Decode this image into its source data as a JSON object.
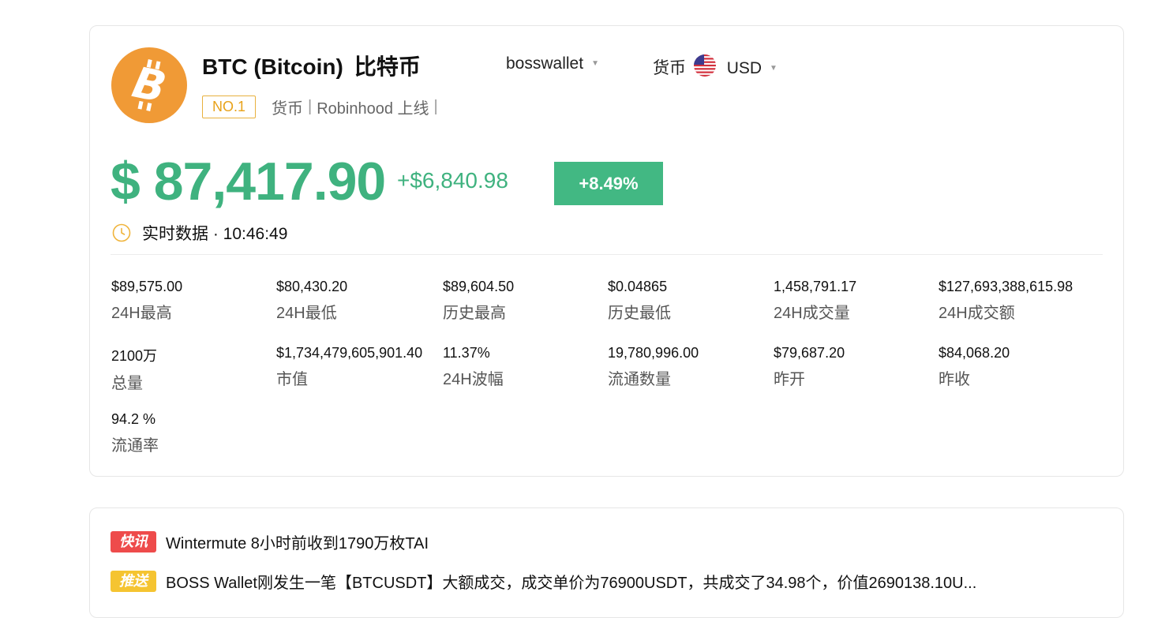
{
  "coin": {
    "symbol_name": "BTC (Bitcoin)",
    "cn_name": "比特币",
    "logo_glyph": "B",
    "logo_color": "#f09a36"
  },
  "wallet_select": {
    "value": "bosswallet"
  },
  "currency_select": {
    "label": "货币",
    "value": "USD",
    "flag": "us-flag-icon"
  },
  "tags": {
    "rank": "NO.1",
    "category": "货币",
    "sep": "|",
    "listing": "Robinhood 上线"
  },
  "price": {
    "value": "$ 87,417.90",
    "change_abs": "+$6,840.98",
    "change_pct": "+8.49%",
    "color": "#3fb27f"
  },
  "realtime": {
    "label": "实时数据 · 10:46:49"
  },
  "stats": [
    {
      "value": "$89,575.00",
      "label": "24H最高"
    },
    {
      "value": "$80,430.20",
      "label": "24H最低"
    },
    {
      "value": "$89,604.50",
      "label": "历史最高"
    },
    {
      "value": "$0.04865",
      "label": "历史最低"
    },
    {
      "value": "1,458,791.17",
      "label": "24H成交量"
    },
    {
      "value": "$127,693,388,615.98",
      "label": "24H成交额"
    },
    {
      "value": "2100万",
      "label": "总量"
    },
    {
      "value": "$1,734,479,605,901.40",
      "label": "市值"
    },
    {
      "value": "11.37%",
      "label": "24H波幅"
    },
    {
      "value": "19,780,996.00",
      "label": "流通数量"
    },
    {
      "value": "$79,687.20",
      "label": "昨开"
    },
    {
      "value": "$84,068.20",
      "label": "昨收"
    },
    {
      "value": "94.2 %",
      "label": "流通率"
    }
  ],
  "news": [
    {
      "badge": "快讯",
      "text": "Wintermute 8小时前收到1790万枚TAI"
    },
    {
      "badge": "推送",
      "text": "BOSS Wallet刚发生一笔【BTCUSDT】大额成交，成交单价为76900USDT，共成交了34.98个，价值2690138.10U..."
    }
  ]
}
